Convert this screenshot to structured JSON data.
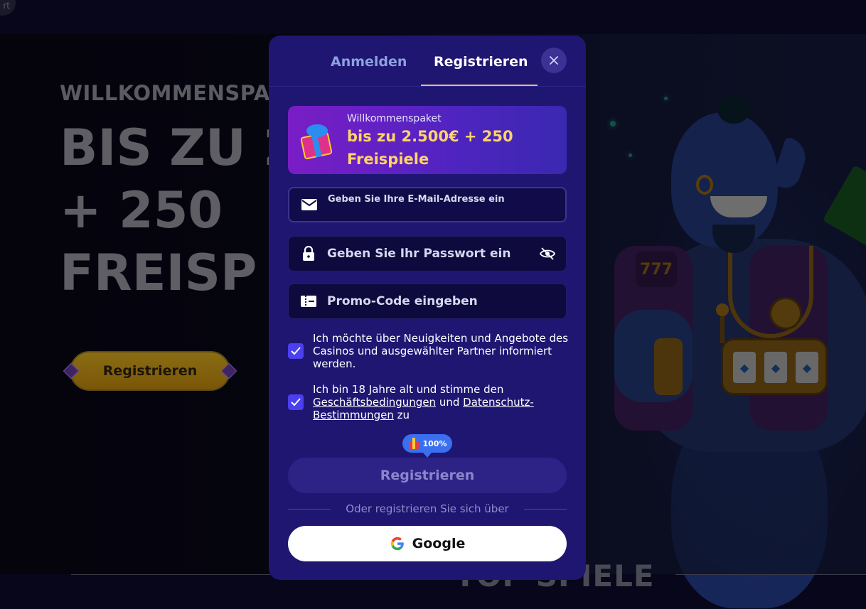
{
  "background": {
    "corner_glyph": "rt",
    "hero": {
      "kicker": "WILLKOMMENSPA",
      "line1": "BIS ZU 2",
      "line2": "+ 250",
      "line3": "FREISP",
      "button_label": "Registrieren"
    },
    "section_title": "TOP SPIELE",
    "genie_badge": "777"
  },
  "modal": {
    "tabs": [
      {
        "label": "Anmelden",
        "active": false
      },
      {
        "label": "Registrieren",
        "active": true
      }
    ],
    "close_icon": "close-icon",
    "promo_banner": {
      "kicker": "Willkommenspaket",
      "title": "bis zu 2.500€ + 250 Freispiele",
      "icon": "gift-icon"
    },
    "email": {
      "placeholder": "Geben Sie Ihre E-Mail-Adresse ein",
      "value": "",
      "icon": "mail-icon"
    },
    "password": {
      "placeholder": "Geben Sie Ihr Passwort ein",
      "value": "",
      "icon": "lock-icon",
      "toggle_icon": "eye-off-icon"
    },
    "promo_code": {
      "placeholder": "Promo-Code eingeben",
      "value": "",
      "icon": "ticket-icon"
    },
    "news_consent": {
      "checked": true,
      "text": "Ich möchte über Neuigkeiten und Angebote des Casinos und ausgewählter Partner informiert werden."
    },
    "terms_consent": {
      "checked": true,
      "prefix": "Ich bin 18 Jahre alt und stimme den ",
      "terms_link": "Geschäftsbedingungen",
      "middle": " und ",
      "privacy_link": "Datenschutz-Bestimmungen",
      "suffix": " zu"
    },
    "bonus_chip": "100%",
    "register_button": "Registrieren",
    "or_text": "Oder registrieren Sie sich über",
    "google_button": "Google"
  },
  "colors": {
    "modal_bg": "#1f1672",
    "accent_gold": "#ffd46a",
    "checkbox": "#4b3ff0",
    "tab_underline": "#e9c16a"
  }
}
